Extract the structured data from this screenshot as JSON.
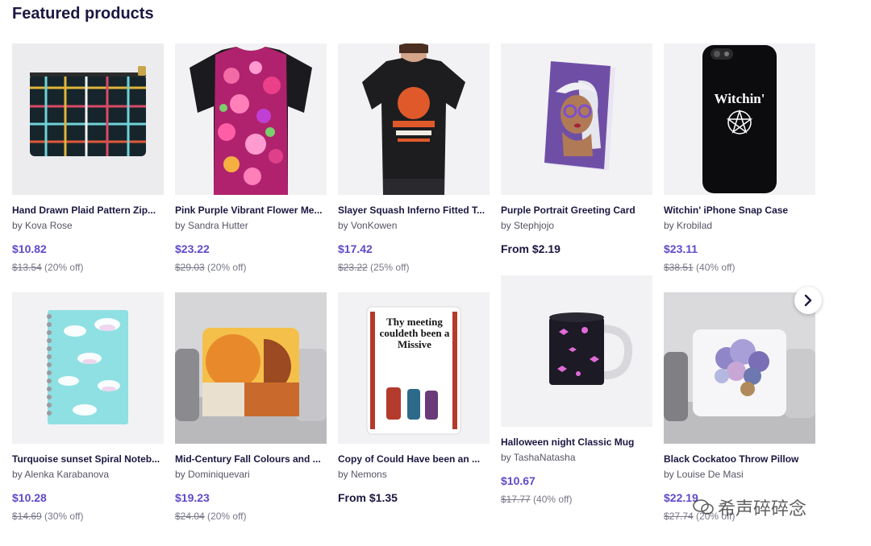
{
  "section": {
    "title": "Featured products"
  },
  "products": [
    {
      "title": "Hand Drawn Plaid Pattern Zip...",
      "artist": "by Kova Rose",
      "price": "$10.82",
      "was": "$13.54",
      "discount": "(20% off)"
    },
    {
      "title": "Pink Purple Vibrant Flower Me...",
      "artist": "by Sandra Hutter",
      "price": "$23.22",
      "was": "$29.03",
      "discount": "(20% off)"
    },
    {
      "title": "Slayer Squash Inferno Fitted T...",
      "artist": "by VonKowen",
      "price": "$17.42",
      "was": "$23.22",
      "discount": "(25% off)"
    },
    {
      "title": "Purple Portrait Greeting Card",
      "artist": "by Stephjojo",
      "price": "From $2.19"
    },
    {
      "title": "Witchin' iPhone Snap Case",
      "artist": "by Krobilad",
      "price": "$23.11",
      "was": "$38.51",
      "discount": "(40% off)",
      "art_text": "Witchin'"
    },
    {
      "title": "Turquoise sunset Spiral Noteb...",
      "artist": "by Alenka Karabanova",
      "price": "$10.28",
      "was": "$14.69",
      "discount": "(30% off)"
    },
    {
      "title": "Mid-Century Fall Colours and ...",
      "artist": "by Dominiquevari",
      "price": "$19.23",
      "was": "$24.04",
      "discount": "(20% off)"
    },
    {
      "title": "Copy of Could Have been an ...",
      "artist": "by Nemons",
      "price": "From $1.35",
      "art_text": "Thy meeting couldeth been a Missive"
    },
    {
      "title": "Halloween night Classic Mug",
      "artist": "by TashaNatasha",
      "price": "$10.67",
      "was": "$17.77",
      "discount": "(40% off)"
    },
    {
      "title": "Black Cockatoo Throw Pillow",
      "artist": "by Louise De Masi",
      "price": "$22.19",
      "was": "$27.74",
      "discount": "(20% off)"
    }
  ],
  "carousel": {
    "next_icon": "chevron-right-icon"
  },
  "watermark": {
    "text": "希声碎碎念"
  }
}
